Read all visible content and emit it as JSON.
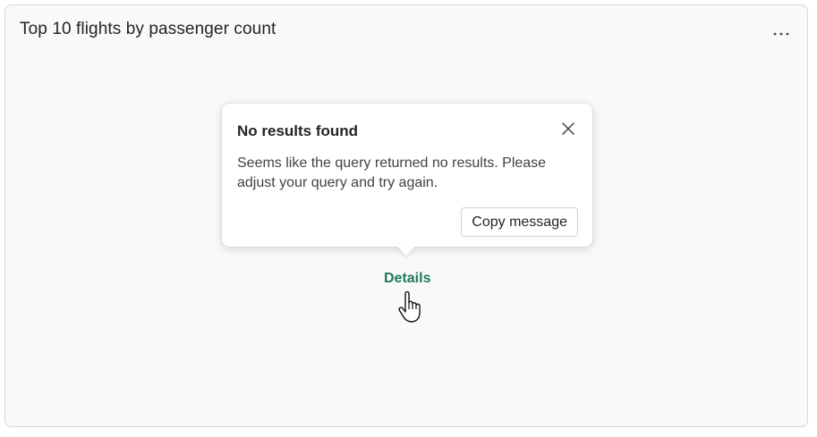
{
  "card": {
    "title": "Top 10 flights by passenger count",
    "more_label": "..."
  },
  "popover": {
    "title": "No results found",
    "message": "Seems like the query returned no results. Please adjust your query and try again.",
    "copy_button": "Copy message",
    "close_icon": "close-icon"
  },
  "details_link": "Details",
  "colors": {
    "link": "#1e7a5c",
    "card_bg": "#f9f9f9",
    "border": "#d6d6d6"
  },
  "icons": {
    "more": "more-horizontal-icon",
    "close": "close-icon",
    "cursor": "hand-pointer-cursor"
  }
}
